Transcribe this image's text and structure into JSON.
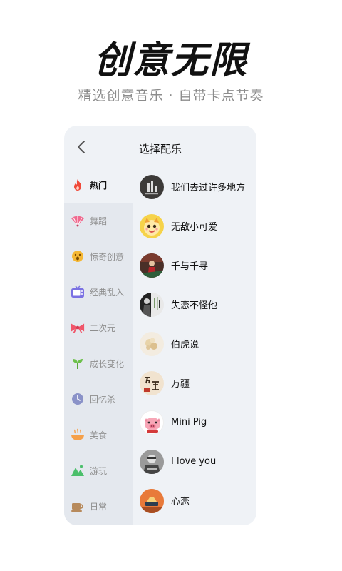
{
  "hero": {
    "title": "创意无限",
    "subtitle": "精选创意音乐 · 自带卡点节奏"
  },
  "panel": {
    "back_icon": "chevron-left-icon",
    "title": "选择配乐"
  },
  "sidebar": {
    "active_index": 0,
    "items": [
      {
        "label": "热门",
        "icon": "flame-icon",
        "color": "#f04a3a"
      },
      {
        "label": "舞蹈",
        "icon": "fan-icon",
        "color": "#f06a8f"
      },
      {
        "label": "惊奇创意",
        "icon": "surprised-face-icon",
        "color": "#f5b733"
      },
      {
        "label": "经典乱入",
        "icon": "tv-icon",
        "color": "#7b72e3"
      },
      {
        "label": "二次元",
        "icon": "bow-icon",
        "color": "#f0566a"
      },
      {
        "label": "成长变化",
        "icon": "sprout-icon",
        "color": "#6cc04a"
      },
      {
        "label": "回忆杀",
        "icon": "clock-icon",
        "color": "#8a92c8"
      },
      {
        "label": "美食",
        "icon": "bowl-icon",
        "color": "#f5a04a"
      },
      {
        "label": "游玩",
        "icon": "mountain-icon",
        "color": "#4bbf6b"
      },
      {
        "label": "日常",
        "icon": "coffee-cup-icon",
        "color": "#b78a5c"
      }
    ]
  },
  "songs": [
    {
      "title": "我们去过许多地方"
    },
    {
      "title": "无敌小可爱"
    },
    {
      "title": "千与千寻"
    },
    {
      "title": "失恋不怪他"
    },
    {
      "title": "伯虎说"
    },
    {
      "title": "万疆"
    },
    {
      "title": "Mini Pig"
    },
    {
      "title": "I love you"
    },
    {
      "title": "心恋"
    }
  ]
}
